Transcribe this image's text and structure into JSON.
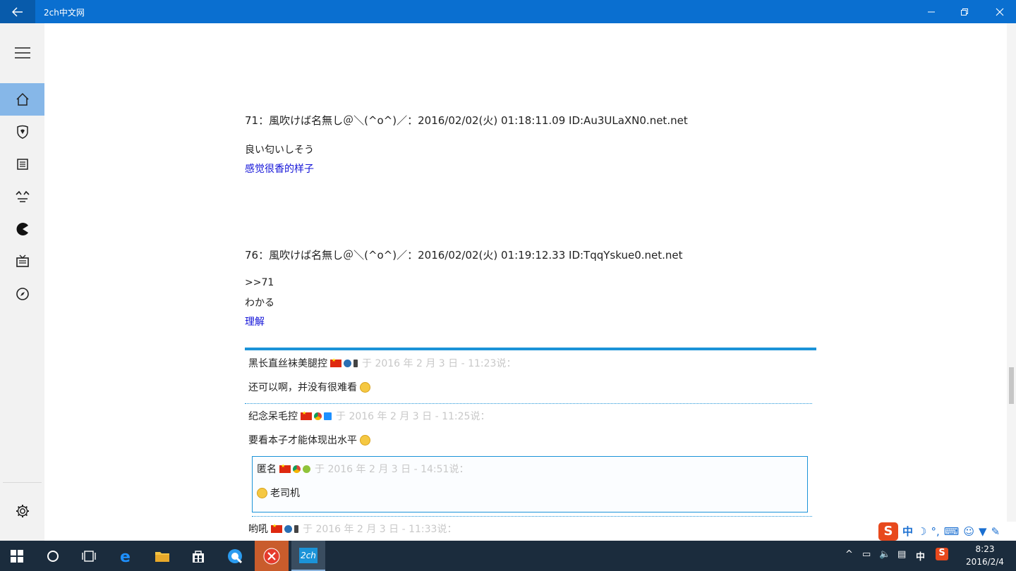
{
  "window": {
    "title": "2ch中文网"
  },
  "sidebar": {
    "items": [
      {
        "icon": "menu-icon"
      },
      {
        "icon": "home-icon",
        "active": true
      },
      {
        "icon": "heart-shield-icon"
      },
      {
        "icon": "document-icon"
      },
      {
        "icon": "face-icon"
      },
      {
        "icon": "pacman-icon"
      },
      {
        "icon": "tv-icon"
      },
      {
        "icon": "compass-icon"
      },
      {
        "icon": "gear-icon"
      }
    ]
  },
  "posts": [
    {
      "header": "71：風吹けば名無し＠＼(^o^)／：2016/02/02(火) 01:18:11.09 ID:Au3ULaXN0.net.net",
      "lines": [
        "良い匂いしそう"
      ],
      "translation": "感觉很香的样子"
    },
    {
      "header": "76：風吹けば名無し＠＼(^o^)／：2016/02/02(火) 01:19:12.33 ID:TqqYskue0.net.net",
      "lines": [
        ">>71",
        "わかる"
      ],
      "translation": "理解"
    }
  ],
  "comments": [
    {
      "author": "黑长直丝袜美腿控",
      "meta": "于 2016 年 2 月 3 日 - 11:23说：",
      "text": "还可以啊，并没有很难看"
    },
    {
      "author": "纪念呆毛控",
      "meta": "于 2016 年 2 月 3 日 - 11:25说：",
      "text": "要看本子才能体现出水平"
    },
    {
      "author": "匿名",
      "meta": "于 2016 年 2 月 3 日 - 14:51说：",
      "text": "老司机"
    },
    {
      "author": "哟吼",
      "meta": "于 2016 年 2 月 3 日 - 11:33说："
    }
  ],
  "ime": {
    "logo": "S",
    "mode": "中"
  },
  "taskbar": {
    "apps": [
      "windows-start-icon",
      "cortana-icon",
      "task-view-icon",
      "edge-icon",
      "file-explorer-icon",
      "store-icon",
      "qq-browser-icon",
      "close-app-icon",
      "2ch-app-icon"
    ],
    "app_2ch_label": "2ch",
    "tray_lang": "中",
    "tray_s": "S",
    "time": "8:23",
    "date": "2016/2/4"
  },
  "colors": {
    "titlebar": "#0a6fd0",
    "accent": "#1b93d8",
    "translation": "#1414d8",
    "taskbar": "#1b2c3d"
  }
}
